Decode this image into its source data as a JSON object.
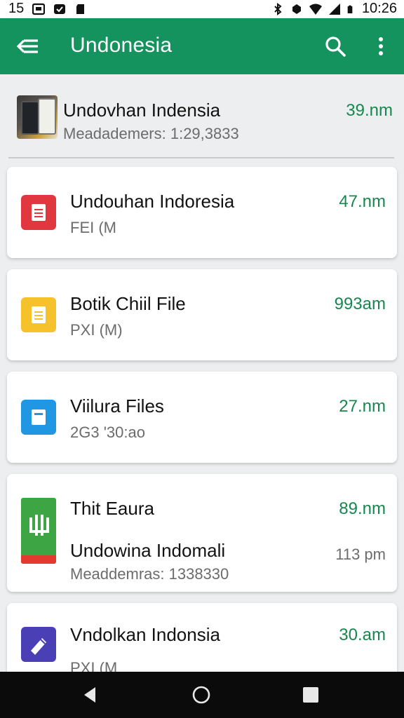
{
  "status_bar": {
    "left_number": "15",
    "time": "10:26",
    "icons": [
      "image-icon",
      "sync-icon",
      "sd-card-icon",
      "bluetooth-icon",
      "vibrate-icon",
      "wifi-icon",
      "signal-icon",
      "battery-icon"
    ]
  },
  "app_bar": {
    "title": "Undonesia",
    "back_icon": "back-arrow-icon",
    "search_icon": "search-icon",
    "more_icon": "more-vert-icon",
    "color": "#15935f"
  },
  "rows": [
    {
      "title": "Undovhan Indensia",
      "subtitle": "Meadademers: 1:29,3833",
      "time": "39.nm",
      "icon": "photo-thumbnail"
    },
    {
      "title": "Undouhan Indoresia",
      "subtitle": "FEI (M",
      "time": "47.nm",
      "icon": "document-icon",
      "icon_color": "#e0383e"
    },
    {
      "title": "Botik Chiil File",
      "subtitle": "PXI (M)",
      "time": "993am",
      "icon": "document-icon",
      "icon_color": "#f5c22b"
    },
    {
      "title": "Viilura Files",
      "subtitle": "2G3 '30:ao",
      "time": "27.nm",
      "icon": "folder-icon",
      "icon_color": "#2196e3"
    },
    {
      "title": "Thit Eaura",
      "title2": "Undowina Indomali",
      "subtitle": "Meaddemras: 1338330",
      "time": "89.nm",
      "time2": "113 pm",
      "icon": "app-icon",
      "icon_color": "#3da544"
    },
    {
      "title": "Vndolkan Indonsia",
      "subtitle": "PXI (M",
      "time": "30.am",
      "icon": "edit-icon",
      "icon_color": "#4b3fb5"
    }
  ],
  "nav_bar": {
    "back": "nav-back-icon",
    "home": "nav-home-icon",
    "recents": "nav-recents-icon"
  }
}
